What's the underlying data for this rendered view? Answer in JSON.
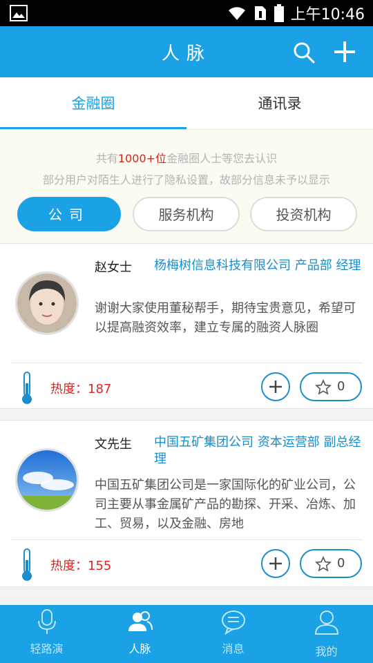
{
  "statusbar": {
    "time": "上午10:46"
  },
  "header": {
    "title": "人脉"
  },
  "tabs": [
    {
      "label": "金融圈",
      "active": true
    },
    {
      "label": "通讯录",
      "active": false
    }
  ],
  "info": {
    "line1_prefix": "共有",
    "line1_highlight": "1000+位",
    "line1_suffix": "金融圈人士等您去认识",
    "line2": "部分用户对陌生人进行了隐私设置，故部分信息未予以显示"
  },
  "filters": [
    {
      "label": "公司",
      "active": true
    },
    {
      "label": "服务机构",
      "active": false
    },
    {
      "label": "投资机构",
      "active": false
    }
  ],
  "cards": [
    {
      "name": "赵女士",
      "company": "杨梅树信息科技有限公司 产品部 经理",
      "description": "谢谢大家使用董秘帮手，期待宝贵意见，希望可以提高融资效率，建立专属的融资人脉圈",
      "heat_label": "热度：187",
      "favorites": "0"
    },
    {
      "name": "文先生",
      "company": "中国五矿集团公司 资本运营部 副总经理",
      "description": "中国五矿集团公司是一家国际化的矿业公司，公司主要从事金属矿产品的勘探、开采、冶炼、加工、贸易，以及金融、房地",
      "heat_label": "热度：155",
      "favorites": "0"
    }
  ],
  "bottomnav": [
    {
      "label": "轻路演",
      "icon": "microphone-icon",
      "active": false
    },
    {
      "label": "人脉",
      "icon": "contacts-icon",
      "active": true
    },
    {
      "label": "消息",
      "icon": "message-icon",
      "active": false
    },
    {
      "label": "我的",
      "icon": "profile-icon",
      "active": false
    }
  ],
  "colors": {
    "brand": "#1aa1e6",
    "link": "#1a8dcc",
    "heat": "#e02323",
    "highlight": "#d4261c"
  }
}
